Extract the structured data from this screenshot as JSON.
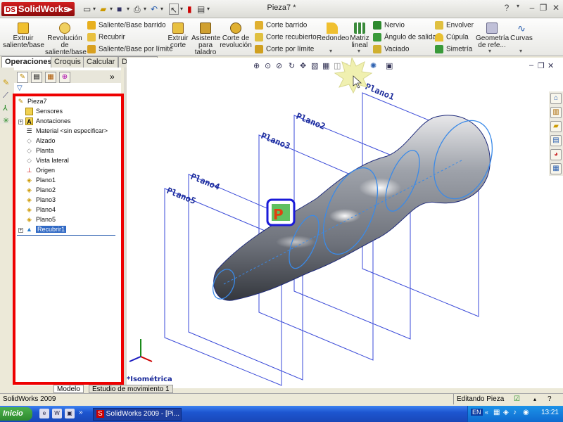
{
  "app": {
    "brand": "SolidWorks",
    "window_title": "Pieza7 *",
    "help": "?"
  },
  "ribbon": {
    "extruir_saliente": "Extruir saliente/base",
    "revolucion_saliente": "Revolución de saliente/base",
    "saliente_barrido": "Saliente/Base barrido",
    "recubrir": "Recubrir",
    "saliente_limite": "Saliente/Base por límite",
    "extruir_corte": "Extruir corte",
    "asistente_taladro": "Asistente para taladro",
    "corte_revolucion": "Corte de revolución",
    "corte_barrido": "Corte barrido",
    "corte_recubierto": "Corte recubierto",
    "corte_limite": "Corte por límite",
    "redondeo": "Redondeo",
    "matriz_lineal": "Matriz lineal",
    "nervio": "Nervio",
    "angulo_salida": "Ángulo de salida",
    "vaciado": "Vaciado",
    "envolver": "Envolver",
    "cupula": "Cúpula",
    "simetria": "Simetría",
    "geometria_ref": "Geometría de refe...",
    "curvas": "Curvas"
  },
  "cm_tabs": [
    "Operaciones",
    "Croquis",
    "Calcular",
    "DimXpert"
  ],
  "tree": {
    "root": "Pieza7",
    "items": [
      {
        "label": "Sensores",
        "icon": "sensor-icon"
      },
      {
        "label": "Anotaciones",
        "icon": "annotation-icon"
      },
      {
        "label": "Material <sin especificar>",
        "icon": "material-icon"
      },
      {
        "label": "Alzado",
        "icon": "plane-icon"
      },
      {
        "label": "Planta",
        "icon": "plane-icon"
      },
      {
        "label": "Vista lateral",
        "icon": "plane-icon"
      },
      {
        "label": "Origen",
        "icon": "origin-icon"
      },
      {
        "label": "Plano1",
        "icon": "plane-icon"
      },
      {
        "label": "Plano2",
        "icon": "plane-icon"
      },
      {
        "label": "Plano3",
        "icon": "plane-icon"
      },
      {
        "label": "Plano4",
        "icon": "plane-icon"
      },
      {
        "label": "Plano5",
        "icon": "plane-icon"
      },
      {
        "label": "Recubrir1",
        "icon": "loft-icon"
      }
    ]
  },
  "viewport": {
    "planes": [
      "Plano1",
      "Plano2",
      "Plano3",
      "Plano4",
      "Plano5"
    ],
    "view_label": "*Isométrica",
    "badge": "P"
  },
  "bottom_tabs": [
    "Modelo",
    "Estudio de movimiento 1"
  ],
  "status": {
    "left": "SolidWorks 2009",
    "right": "Editando Pieza"
  },
  "taskbar": {
    "start": "Inicio",
    "task": "SolidWorks 2009 - [Pi...",
    "lang": "EN",
    "time": "13:21"
  }
}
